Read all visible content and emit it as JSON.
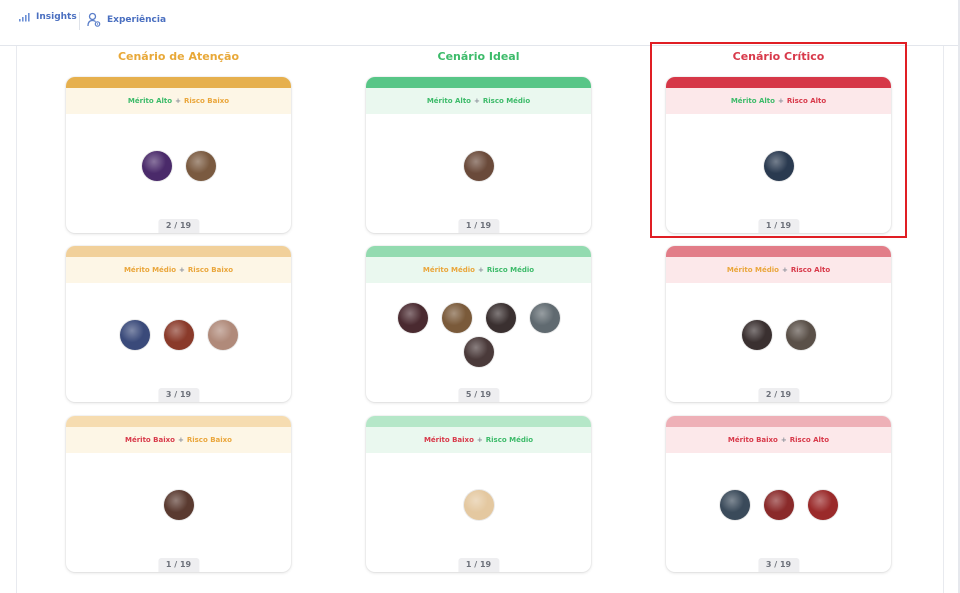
{
  "nav": {
    "insights_label": "Insights",
    "experiencia_label": "Experiência"
  },
  "columns": [
    {
      "title": "Cenário de Atenção",
      "color": "#e8a838"
    },
    {
      "title": "Cenário Ideal",
      "color": "#3dbb6a"
    },
    {
      "title": "Cenário Crítico",
      "color": "#d8394a"
    }
  ],
  "colors": {
    "green": "#3dbb6a",
    "orange": "#eaa63b",
    "red": "#d8394a",
    "highlight": "#e01e24"
  },
  "cards": [
    {
      "merit": "Mérito Alto",
      "risk": "Risco Baixo",
      "count": "2 / 19",
      "bar": "#e6b04e",
      "bg": "#fdf6e6",
      "avatars": [
        {
          "name": "avatar-purple",
          "color": "#4a2a6a"
        },
        {
          "name": "avatar-blonde",
          "color": "#7a5a40"
        }
      ]
    },
    {
      "merit": "Mérito Alto",
      "risk": "Risco Médio",
      "count": "1 / 19",
      "bar": "#58c687",
      "bg": "#eaf8ef",
      "avatars": [
        {
          "name": "avatar-thanos",
          "color": "#6a4a3a"
        }
      ]
    },
    {
      "merit": "Mérito Alto",
      "risk": "Risco Alto",
      "count": "1 / 19",
      "bar": "#d63848",
      "bg": "#fce8ea",
      "avatars": [
        {
          "name": "avatar-blue-helmet",
          "color": "#2a3a50"
        }
      ]
    },
    {
      "merit": "Mérito Médio",
      "risk": "Risco Baixo",
      "count": "3 / 19",
      "bar": "#f1d09a",
      "bg": "#fdf6e6",
      "avatars": [
        {
          "name": "avatar-blue",
          "color": "#3a4a7a"
        },
        {
          "name": "avatar-red-gold",
          "color": "#8a3a2a"
        },
        {
          "name": "avatar-man",
          "color": "#b08a7a"
        }
      ]
    },
    {
      "merit": "Mérito Médio",
      "risk": "Risco Médio",
      "count": "5 / 19",
      "bar": "#93dbb0",
      "bg": "#eaf8ef",
      "avatars": [
        {
          "name": "avatar-woman-dark",
          "color": "#4a2a30"
        },
        {
          "name": "avatar-loki",
          "color": "#7a5a3a"
        },
        {
          "name": "avatar-fury",
          "color": "#3a3030"
        },
        {
          "name": "avatar-bruce",
          "color": "#606a70"
        },
        {
          "name": "avatar-tony",
          "color": "#4a3a3a"
        }
      ]
    },
    {
      "merit": "Mérito Médio",
      "risk": "Risco Alto",
      "count": "2 / 19",
      "bar": "#e27d88",
      "bg": "#fce8ea",
      "avatars": [
        {
          "name": "avatar-falcon",
          "color": "#3a3030"
        },
        {
          "name": "avatar-hawkeye",
          "color": "#5a5048"
        }
      ]
    },
    {
      "merit": "Mérito Baixo",
      "risk": "Risco Baixo",
      "count": "1 / 19",
      "bar": "#f6dcb0",
      "bg": "#fdf6e6",
      "avatars": [
        {
          "name": "avatar-brunette",
          "color": "#5a3a30"
        }
      ]
    },
    {
      "merit": "Mérito Baixo",
      "risk": "Risco Médio",
      "count": "1 / 19",
      "bar": "#b5e7c8",
      "bg": "#eaf8ef",
      "avatars": [
        {
          "name": "avatar-carol",
          "color": "#e4c8a0"
        }
      ]
    },
    {
      "merit": "Mérito Baixo",
      "risk": "Risco Alto",
      "count": "3 / 19",
      "bar": "#eeb0b7",
      "bg": "#fce8ea",
      "avatars": [
        {
          "name": "avatar-bucky",
          "color": "#3a4a5a"
        },
        {
          "name": "avatar-spider",
          "color": "#8a2a2a"
        },
        {
          "name": "avatar-wanda",
          "color": "#9a2a2a"
        }
      ]
    }
  ]
}
